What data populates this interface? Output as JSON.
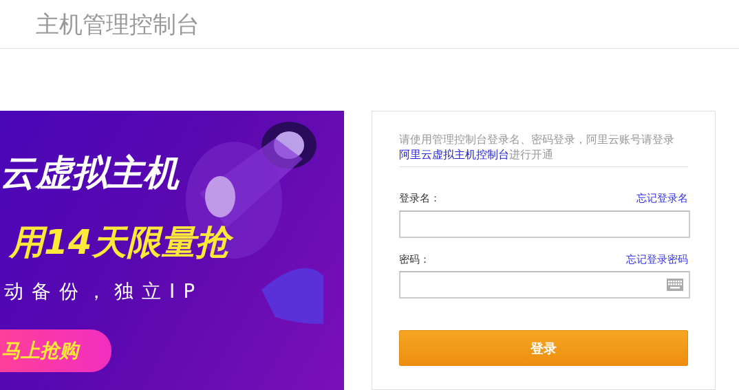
{
  "header": {
    "title": "主机管理控制台"
  },
  "banner": {
    "headline": "云虚拟主机",
    "offer": "用14天限量抢",
    "features": "动备份，独立IP",
    "cta": "马上抢购"
  },
  "login": {
    "notice": {
      "before": "请使用管理控制台登录名、密码登录，阿里云账号请登录",
      "link": "阿里云虚拟主机控制台",
      "after": "进行开通"
    },
    "fields": [
      {
        "kind": "text",
        "label": "登录名：",
        "link": "忘记登录名"
      },
      {
        "kind": "password",
        "label": "密码：",
        "link": "忘记登录密码"
      }
    ],
    "submit": "登录"
  }
}
